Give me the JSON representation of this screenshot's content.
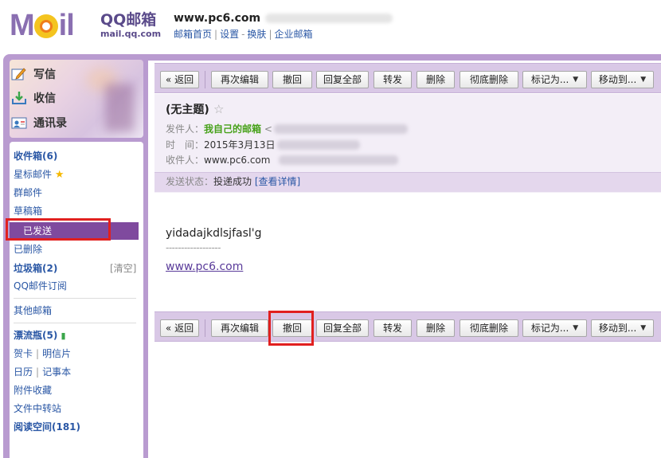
{
  "header": {
    "logo_brand": "QQ邮箱",
    "logo_domain": "mail.qq.com",
    "account": "www.pc6.com",
    "links": [
      "邮箱首页",
      "设置",
      "换肤",
      "企业邮箱"
    ]
  },
  "nav": {
    "compose": "写信",
    "inbox_check": "收信",
    "contacts": "通讯录"
  },
  "folders": {
    "inbox": "收件箱(6)",
    "starred": "星标邮件",
    "group": "群邮件",
    "drafts": "草稿箱",
    "sent": "已发送",
    "deleted": "已删除",
    "spam": "垃圾箱(2)",
    "spam_clear": "[清空]",
    "subscriptions": "QQ邮件订阅",
    "other": "其他邮箱",
    "bottle": "漂流瓶(5)",
    "cards": "贺卡",
    "postcards": "明信片",
    "calendar": "日历",
    "notes": "记事本",
    "attachments": "附件收藏",
    "transfer": "文件中转站",
    "reading": "阅读空间(181)"
  },
  "toolbar": {
    "back": "« 返回",
    "reedit": "再次编辑",
    "recall": "撤回",
    "reply_all": "回复全部",
    "forward": "转发",
    "delete": "删除",
    "delete_forever": "彻底删除",
    "mark_as": "标记为...",
    "move_to": "移动到..."
  },
  "message": {
    "subject": "(无主题)",
    "sender_label": "发件人：",
    "sender_name": "我自己的邮箱",
    "sender_bracket": "<",
    "time_label": "时　间：",
    "time_value": "2015年3月13日",
    "recipient_label": "收件人：",
    "recipient_value": "www.pc6.com",
    "status_label": "发送状态：",
    "status_value": "投递成功",
    "status_link": "[查看详情]",
    "body_line": "yidadajkdlsjfasl'g",
    "body_dashes": "------------------",
    "body_link": "www.pc6.com"
  },
  "colors": {
    "purple_panel": "#b99bd0",
    "selected_folder": "#7f4a9e",
    "highlight_box": "#e1201f",
    "sender_green": "#47a11a",
    "link_blue": "#2a57a5"
  }
}
